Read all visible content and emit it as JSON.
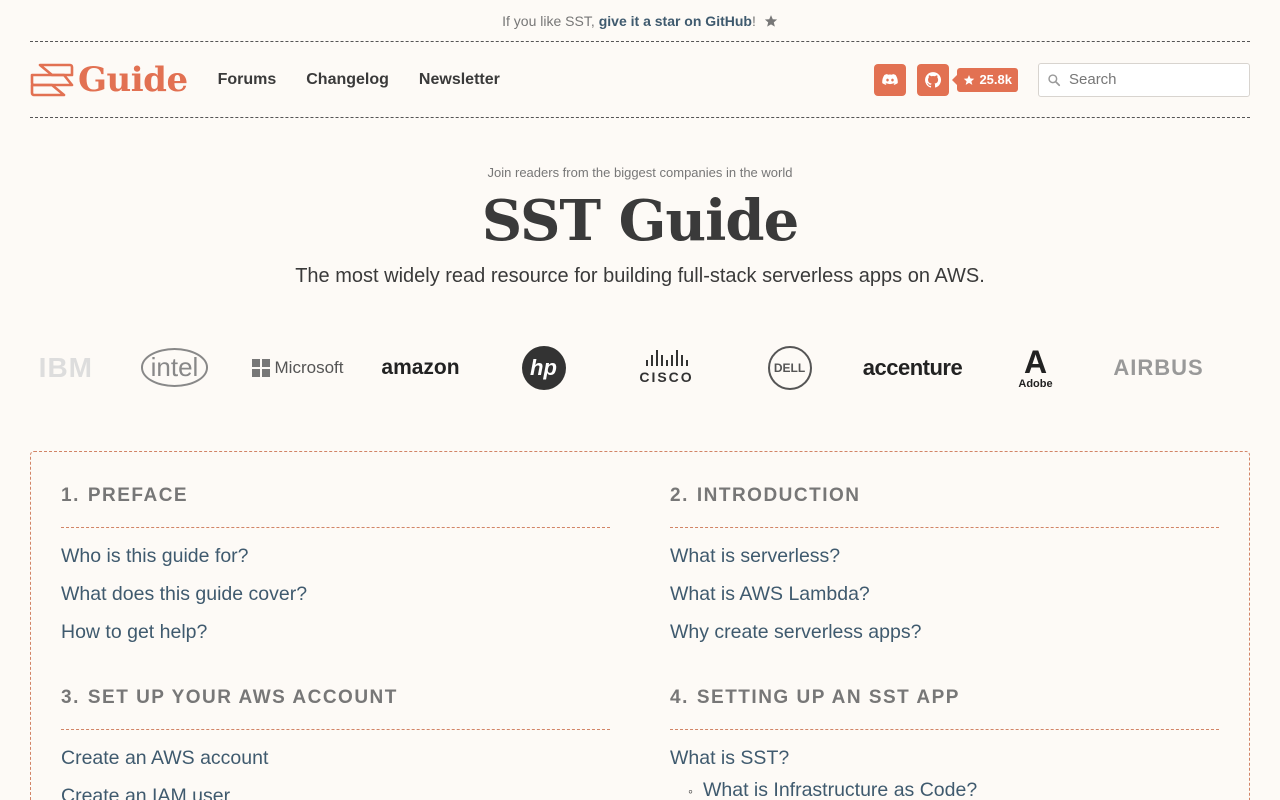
{
  "banner": {
    "prefix": "If you like SST,",
    "link": "give it a star on GitHub",
    "suffix": "!",
    "star_icon": "star-icon"
  },
  "header": {
    "logo_text": "Guide",
    "nav": [
      "Forums",
      "Changelog",
      "Newsletter"
    ],
    "github_stars": "25.8k",
    "search_placeholder": "Search"
  },
  "hero": {
    "kicker": "Join readers from the biggest companies in the world",
    "title": "SST Guide",
    "subtitle": "The most widely read resource for building full-stack serverless apps on AWS."
  },
  "companies": {
    "ibm": "IBM",
    "intel": "intel",
    "microsoft": "Microsoft",
    "amazon": "amazon",
    "hp": "hp",
    "cisco": "CISCO",
    "dell": "DELL",
    "accenture": "accenture",
    "adobe": "Adobe",
    "airbus": "AIRBUS"
  },
  "colors": {
    "accent": "#e27152",
    "link": "#3f5a6e",
    "background": "#fdfaf6"
  },
  "toc": {
    "preface": {
      "num": "1.",
      "title": "PREFACE",
      "items": [
        "Who is this guide for?",
        "What does this guide cover?",
        "How to get help?"
      ]
    },
    "introduction": {
      "num": "2.",
      "title": "INTRODUCTION",
      "items": [
        "What is serverless?",
        "What is AWS Lambda?",
        "Why create serverless apps?"
      ]
    },
    "aws_account": {
      "num": "3.",
      "title": "SET UP YOUR AWS ACCOUNT",
      "items": [
        "Create an AWS account",
        "Create an IAM user"
      ]
    },
    "sst_app": {
      "num": "4.",
      "title": "SETTING UP AN SST APP",
      "items": [
        "What is SST?"
      ],
      "sub_items": [
        "What is Infrastructure as Code?"
      ]
    }
  }
}
